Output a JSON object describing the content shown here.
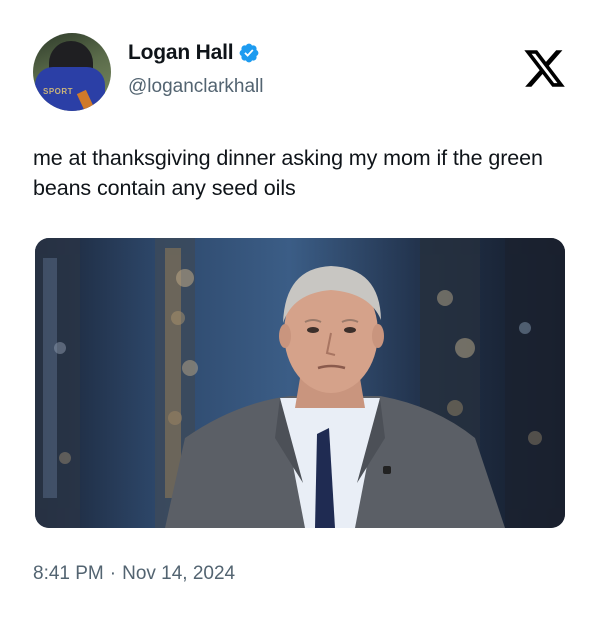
{
  "author": {
    "display_name": "Logan Hall",
    "handle": "@loganclarkhall",
    "verified": true,
    "avatar_patch_text": "SPORT"
  },
  "tweet": {
    "text": "me at thanksgiving dinner asking my mom if the green beans contain any seed oils"
  },
  "meta": {
    "time": "8:41 PM",
    "separator": "·",
    "date": "Nov 14, 2024"
  },
  "icons": {
    "verified": "verified-badge-icon",
    "brand": "x-logo-icon"
  },
  "colors": {
    "verified_blue": "#1d9bf0",
    "secondary_text": "#536471",
    "primary_text": "#0f1419"
  }
}
